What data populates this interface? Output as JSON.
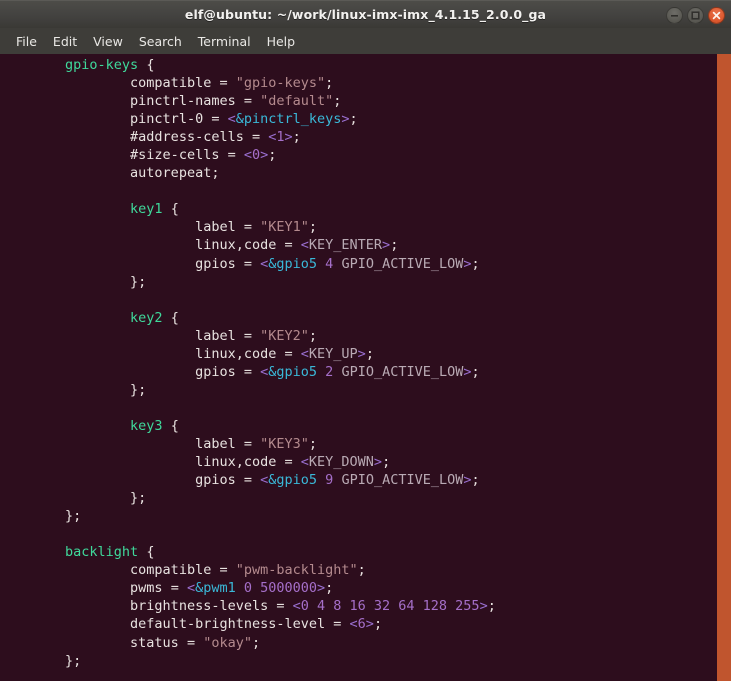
{
  "window": {
    "title": "elf@ubuntu: ~/work/linux-imx-imx_4.1.15_2.0.0_ga",
    "controls": {
      "minimize": "minimize",
      "maximize": "maximize",
      "close": "close"
    }
  },
  "menubar": {
    "items": [
      {
        "label": "File"
      },
      {
        "label": "Edit"
      },
      {
        "label": "View"
      },
      {
        "label": "Search"
      },
      {
        "label": "Terminal"
      },
      {
        "label": "Help"
      }
    ]
  },
  "colors": {
    "terminal_background": "#2d0d1d",
    "titlebar_background": "#434240",
    "menubar_background": "#3e3d39",
    "scrollbar": "#c0552e",
    "close_button": "#df5a30",
    "node_name": "#3fd99b",
    "string": "#b48a8e",
    "reference": "#3ab8d8",
    "number": "#a56fc9",
    "angle_bracket": "#9a6fd0",
    "macro": "#b9aab4",
    "foreground": "#e3dedc"
  },
  "terminal": {
    "lines": [
      [
        {
          "t": "        ",
          "c": "t-plain"
        },
        {
          "t": "gpio-keys",
          "c": "t-node"
        },
        {
          "t": " {",
          "c": "t-punct"
        }
      ],
      [
        {
          "t": "                ",
          "c": "t-plain"
        },
        {
          "t": "compatible",
          "c": "t-prop"
        },
        {
          "t": " = ",
          "c": "t-punct"
        },
        {
          "t": "\"gpio-keys\"",
          "c": "t-string"
        },
        {
          "t": ";",
          "c": "t-punct"
        }
      ],
      [
        {
          "t": "                ",
          "c": "t-plain"
        },
        {
          "t": "pinctrl-names",
          "c": "t-prop"
        },
        {
          "t": " = ",
          "c": "t-punct"
        },
        {
          "t": "\"default\"",
          "c": "t-string"
        },
        {
          "t": ";",
          "c": "t-punct"
        }
      ],
      [
        {
          "t": "                ",
          "c": "t-plain"
        },
        {
          "t": "pinctrl-0",
          "c": "t-prop"
        },
        {
          "t": " = ",
          "c": "t-punct"
        },
        {
          "t": "<",
          "c": "t-angle"
        },
        {
          "t": "&pinctrl_keys",
          "c": "t-ref"
        },
        {
          "t": ">",
          "c": "t-angle"
        },
        {
          "t": ";",
          "c": "t-punct"
        }
      ],
      [
        {
          "t": "                ",
          "c": "t-plain"
        },
        {
          "t": "#address-cells",
          "c": "t-prop"
        },
        {
          "t": " = ",
          "c": "t-punct"
        },
        {
          "t": "<",
          "c": "t-angle"
        },
        {
          "t": "1",
          "c": "t-number"
        },
        {
          "t": ">",
          "c": "t-angle"
        },
        {
          "t": ";",
          "c": "t-punct"
        }
      ],
      [
        {
          "t": "                ",
          "c": "t-plain"
        },
        {
          "t": "#size-cells",
          "c": "t-prop"
        },
        {
          "t": " = ",
          "c": "t-punct"
        },
        {
          "t": "<",
          "c": "t-angle"
        },
        {
          "t": "0",
          "c": "t-number"
        },
        {
          "t": ">",
          "c": "t-angle"
        },
        {
          "t": ";",
          "c": "t-punct"
        }
      ],
      [
        {
          "t": "                ",
          "c": "t-plain"
        },
        {
          "t": "autorepeat",
          "c": "t-prop"
        },
        {
          "t": ";",
          "c": "t-punct"
        }
      ],
      [],
      [
        {
          "t": "                ",
          "c": "t-plain"
        },
        {
          "t": "key1",
          "c": "t-node"
        },
        {
          "t": " {",
          "c": "t-punct"
        }
      ],
      [
        {
          "t": "                        ",
          "c": "t-plain"
        },
        {
          "t": "label",
          "c": "t-prop"
        },
        {
          "t": " = ",
          "c": "t-punct"
        },
        {
          "t": "\"KEY1\"",
          "c": "t-string"
        },
        {
          "t": ";",
          "c": "t-punct"
        }
      ],
      [
        {
          "t": "                        ",
          "c": "t-plain"
        },
        {
          "t": "linux,code",
          "c": "t-prop"
        },
        {
          "t": " = ",
          "c": "t-punct"
        },
        {
          "t": "<",
          "c": "t-angle"
        },
        {
          "t": "KEY_ENTER",
          "c": "t-macro"
        },
        {
          "t": ">",
          "c": "t-angle"
        },
        {
          "t": ";",
          "c": "t-punct"
        }
      ],
      [
        {
          "t": "                        ",
          "c": "t-plain"
        },
        {
          "t": "gpios",
          "c": "t-prop"
        },
        {
          "t": " = ",
          "c": "t-punct"
        },
        {
          "t": "<",
          "c": "t-angle"
        },
        {
          "t": "&gpio5",
          "c": "t-ref"
        },
        {
          "t": " ",
          "c": "t-plain"
        },
        {
          "t": "4",
          "c": "t-number"
        },
        {
          "t": " ",
          "c": "t-plain"
        },
        {
          "t": "GPIO_ACTIVE_LOW",
          "c": "t-macro"
        },
        {
          "t": ">",
          "c": "t-angle"
        },
        {
          "t": ";",
          "c": "t-punct"
        }
      ],
      [
        {
          "t": "                ",
          "c": "t-plain"
        },
        {
          "t": "};",
          "c": "t-punct"
        }
      ],
      [],
      [
        {
          "t": "                ",
          "c": "t-plain"
        },
        {
          "t": "key2",
          "c": "t-node"
        },
        {
          "t": " {",
          "c": "t-punct"
        }
      ],
      [
        {
          "t": "                        ",
          "c": "t-plain"
        },
        {
          "t": "label",
          "c": "t-prop"
        },
        {
          "t": " = ",
          "c": "t-punct"
        },
        {
          "t": "\"KEY2\"",
          "c": "t-string"
        },
        {
          "t": ";",
          "c": "t-punct"
        }
      ],
      [
        {
          "t": "                        ",
          "c": "t-plain"
        },
        {
          "t": "linux,code",
          "c": "t-prop"
        },
        {
          "t": " = ",
          "c": "t-punct"
        },
        {
          "t": "<",
          "c": "t-angle"
        },
        {
          "t": "KEY_UP",
          "c": "t-macro"
        },
        {
          "t": ">",
          "c": "t-angle"
        },
        {
          "t": ";",
          "c": "t-punct"
        }
      ],
      [
        {
          "t": "                        ",
          "c": "t-plain"
        },
        {
          "t": "gpios",
          "c": "t-prop"
        },
        {
          "t": " = ",
          "c": "t-punct"
        },
        {
          "t": "<",
          "c": "t-angle"
        },
        {
          "t": "&gpio5",
          "c": "t-ref"
        },
        {
          "t": " ",
          "c": "t-plain"
        },
        {
          "t": "2",
          "c": "t-number"
        },
        {
          "t": " ",
          "c": "t-plain"
        },
        {
          "t": "GPIO_ACTIVE_LOW",
          "c": "t-macro"
        },
        {
          "t": ">",
          "c": "t-angle"
        },
        {
          "t": ";",
          "c": "t-punct"
        }
      ],
      [
        {
          "t": "                ",
          "c": "t-plain"
        },
        {
          "t": "};",
          "c": "t-punct"
        }
      ],
      [],
      [
        {
          "t": "                ",
          "c": "t-plain"
        },
        {
          "t": "key3",
          "c": "t-node"
        },
        {
          "t": " {",
          "c": "t-punct"
        }
      ],
      [
        {
          "t": "                        ",
          "c": "t-plain"
        },
        {
          "t": "label",
          "c": "t-prop"
        },
        {
          "t": " = ",
          "c": "t-punct"
        },
        {
          "t": "\"KEY3\"",
          "c": "t-string"
        },
        {
          "t": ";",
          "c": "t-punct"
        }
      ],
      [
        {
          "t": "                        ",
          "c": "t-plain"
        },
        {
          "t": "linux,code",
          "c": "t-prop"
        },
        {
          "t": " = ",
          "c": "t-punct"
        },
        {
          "t": "<",
          "c": "t-angle"
        },
        {
          "t": "KEY_DOWN",
          "c": "t-macro"
        },
        {
          "t": ">",
          "c": "t-angle"
        },
        {
          "t": ";",
          "c": "t-punct"
        }
      ],
      [
        {
          "t": "                        ",
          "c": "t-plain"
        },
        {
          "t": "gpios",
          "c": "t-prop"
        },
        {
          "t": " = ",
          "c": "t-punct"
        },
        {
          "t": "<",
          "c": "t-angle"
        },
        {
          "t": "&gpio5",
          "c": "t-ref"
        },
        {
          "t": " ",
          "c": "t-plain"
        },
        {
          "t": "9",
          "c": "t-number"
        },
        {
          "t": " ",
          "c": "t-plain"
        },
        {
          "t": "GPIO_ACTIVE_LOW",
          "c": "t-macro"
        },
        {
          "t": ">",
          "c": "t-angle"
        },
        {
          "t": ";",
          "c": "t-punct"
        }
      ],
      [
        {
          "t": "                ",
          "c": "t-plain"
        },
        {
          "t": "};",
          "c": "t-punct"
        }
      ],
      [
        {
          "t": "        ",
          "c": "t-plain"
        },
        {
          "t": "};",
          "c": "t-punct"
        }
      ],
      [],
      [
        {
          "t": "        ",
          "c": "t-plain"
        },
        {
          "t": "backlight",
          "c": "t-node"
        },
        {
          "t": " {",
          "c": "t-punct"
        }
      ],
      [
        {
          "t": "                ",
          "c": "t-plain"
        },
        {
          "t": "compatible",
          "c": "t-prop"
        },
        {
          "t": " = ",
          "c": "t-punct"
        },
        {
          "t": "\"pwm-backlight\"",
          "c": "t-string"
        },
        {
          "t": ";",
          "c": "t-punct"
        }
      ],
      [
        {
          "t": "                ",
          "c": "t-plain"
        },
        {
          "t": "pwms",
          "c": "t-prop"
        },
        {
          "t": " = ",
          "c": "t-punct"
        },
        {
          "t": "<",
          "c": "t-angle"
        },
        {
          "t": "&pwm1",
          "c": "t-ref"
        },
        {
          "t": " ",
          "c": "t-plain"
        },
        {
          "t": "0 5000000",
          "c": "t-number"
        },
        {
          "t": ">",
          "c": "t-angle"
        },
        {
          "t": ";",
          "c": "t-punct"
        }
      ],
      [
        {
          "t": "                ",
          "c": "t-plain"
        },
        {
          "t": "brightness-levels",
          "c": "t-prop"
        },
        {
          "t": " = ",
          "c": "t-punct"
        },
        {
          "t": "<",
          "c": "t-angle"
        },
        {
          "t": "0 4 8 16 32 64 128 255",
          "c": "t-number"
        },
        {
          "t": ">",
          "c": "t-angle"
        },
        {
          "t": ";",
          "c": "t-punct"
        }
      ],
      [
        {
          "t": "                ",
          "c": "t-plain"
        },
        {
          "t": "default-brightness-level",
          "c": "t-prop"
        },
        {
          "t": " = ",
          "c": "t-punct"
        },
        {
          "t": "<",
          "c": "t-angle"
        },
        {
          "t": "6",
          "c": "t-number"
        },
        {
          "t": ">",
          "c": "t-angle"
        },
        {
          "t": ";",
          "c": "t-punct"
        }
      ],
      [
        {
          "t": "                ",
          "c": "t-plain"
        },
        {
          "t": "status",
          "c": "t-prop"
        },
        {
          "t": " = ",
          "c": "t-punct"
        },
        {
          "t": "\"okay\"",
          "c": "t-string"
        },
        {
          "t": ";",
          "c": "t-punct"
        }
      ],
      [
        {
          "t": "        ",
          "c": "t-plain"
        },
        {
          "t": "};",
          "c": "t-punct"
        }
      ]
    ]
  }
}
